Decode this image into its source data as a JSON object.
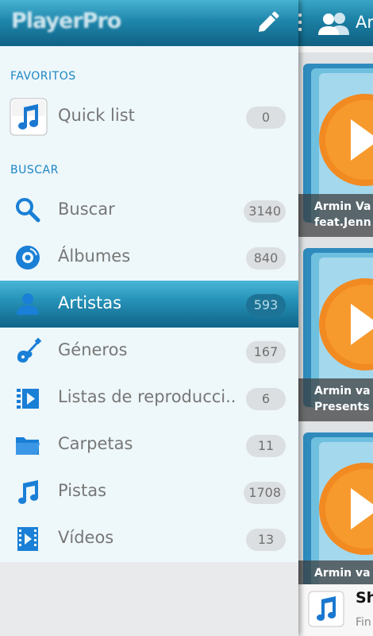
{
  "header": {
    "logo_text": "PlayerPro",
    "edit_icon": "pencil-icon"
  },
  "background": {
    "title": "Ar",
    "albums": [
      {
        "line1": "Armin Va",
        "line2": "feat.Jenn"
      },
      {
        "line1": "Armin va",
        "line2": "Presents"
      },
      {
        "line1": "Armin va",
        "line2": ""
      }
    ],
    "bottom_item": {
      "title": "Sh",
      "subtitle": "Fin"
    }
  },
  "sections": {
    "favorites": "FAVORITOS",
    "browse": "BUSCAR"
  },
  "items": [
    {
      "label": "Quick list",
      "count": "0",
      "icon": "music-note-app-icon"
    },
    {
      "label": "Buscar",
      "count": "3140",
      "icon": "search-icon"
    },
    {
      "label": "Álbumes",
      "count": "840",
      "icon": "disc-icon"
    },
    {
      "label": "Artistas",
      "count": "593",
      "icon": "person-icon",
      "selected": true
    },
    {
      "label": "Géneros",
      "count": "167",
      "icon": "guitar-icon"
    },
    {
      "label": "Listas de reproducci..",
      "count": "6",
      "icon": "playlist-icon"
    },
    {
      "label": "Carpetas",
      "count": "11",
      "icon": "folder-icon"
    },
    {
      "label": "Pistas",
      "count": "1708",
      "icon": "music-note-icon"
    },
    {
      "label": "Vídeos",
      "count": "13",
      "icon": "video-icon"
    }
  ],
  "colors": {
    "accent": "#1c86c4",
    "header": "#1f86ab",
    "selected_row": "#2793b9"
  }
}
